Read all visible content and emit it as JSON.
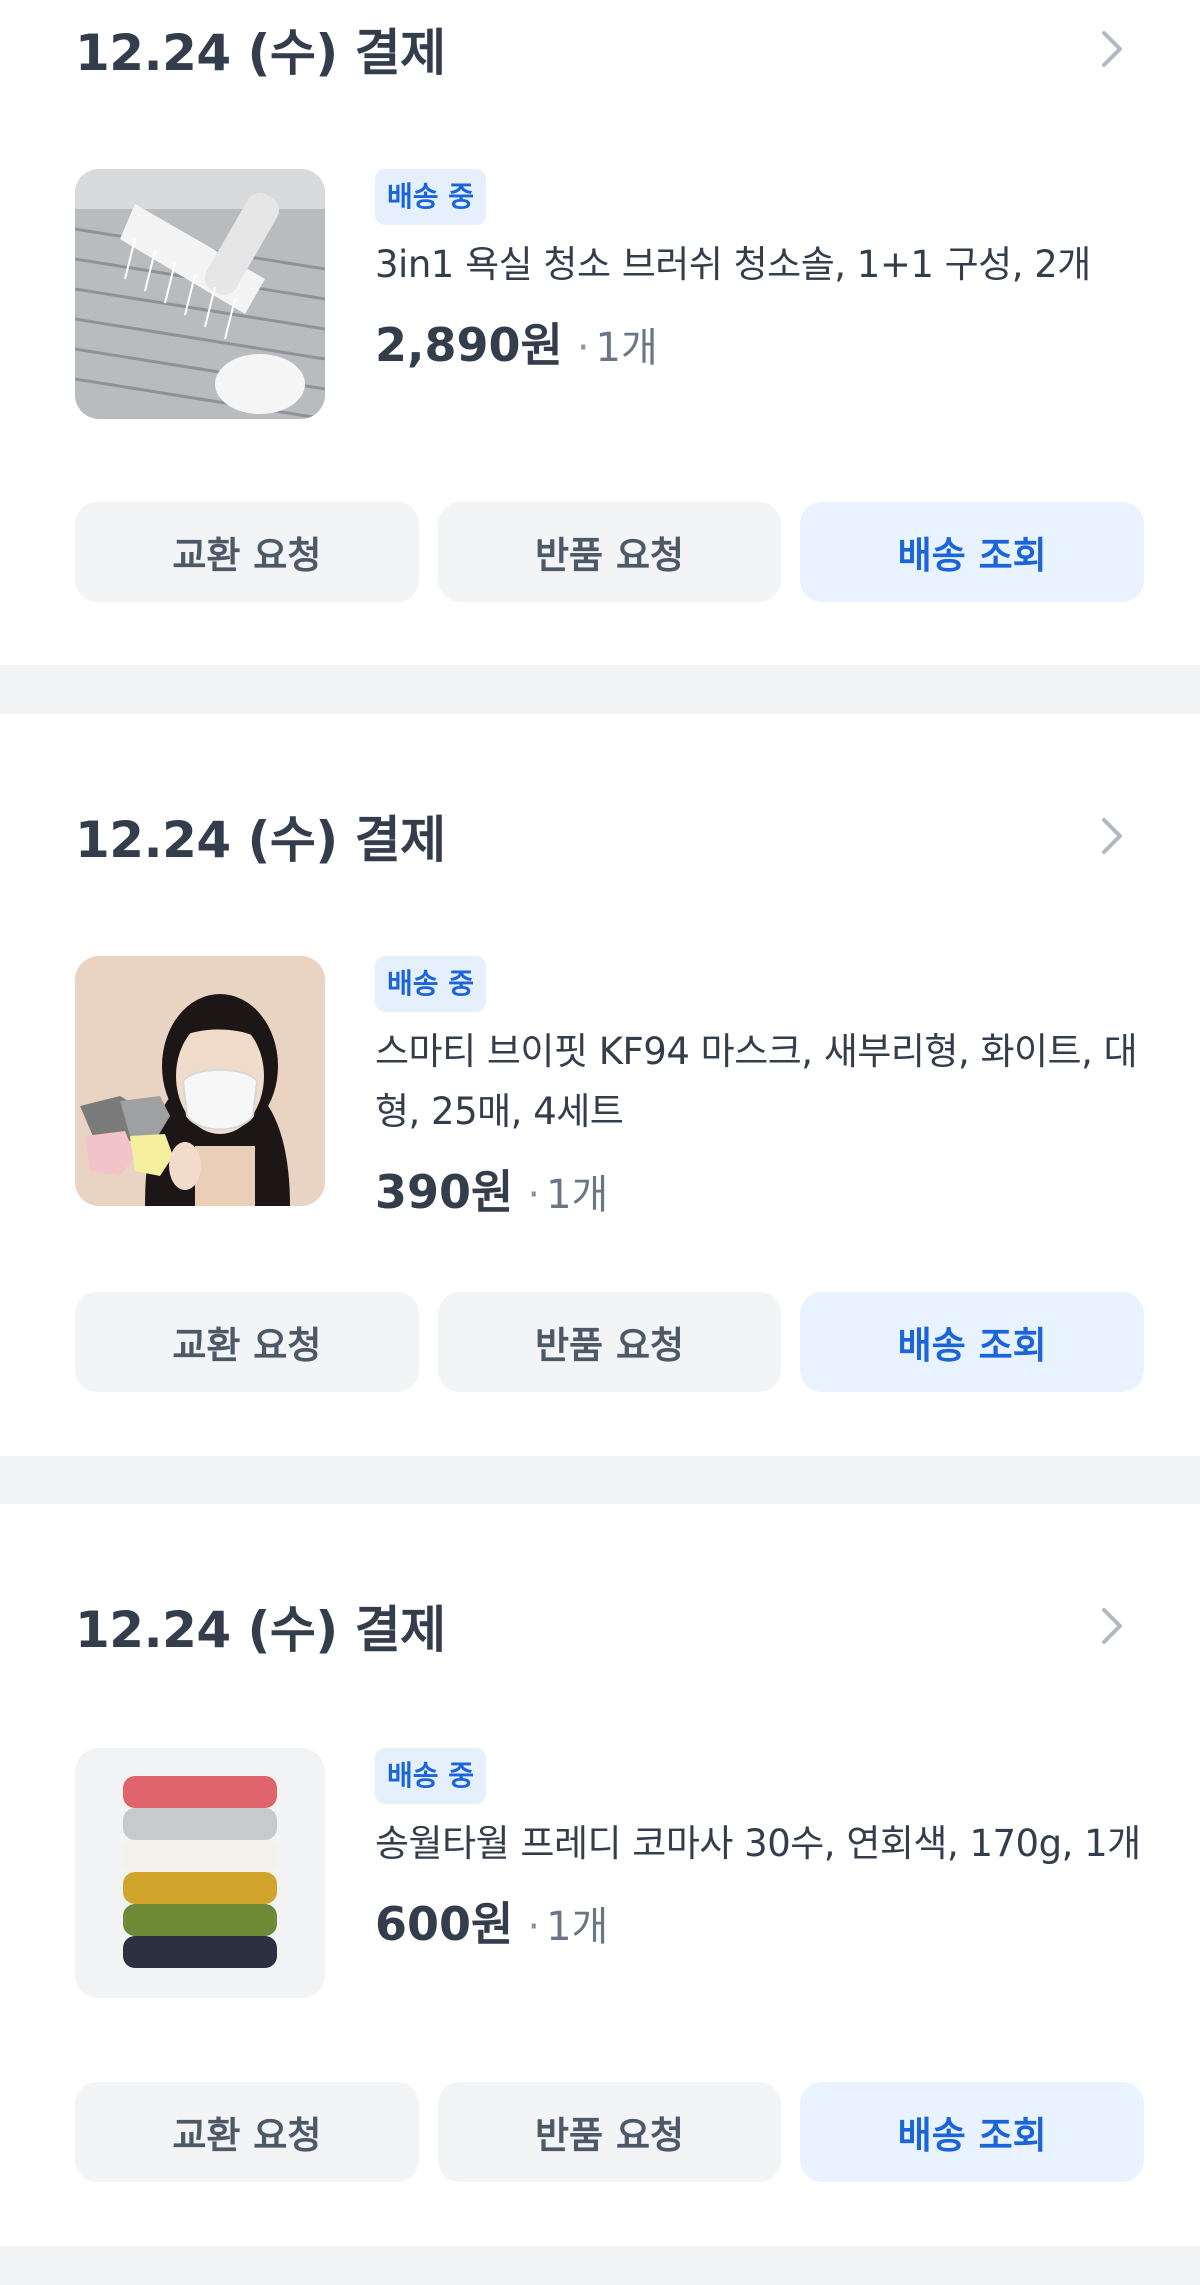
{
  "orders": [
    {
      "date": "12.24 (수) 결제",
      "status": "배송 중",
      "product_name": "3in1 욕실 청소 브러쉬 청소솔, 1+1 구성, 2개",
      "price": "2,890원",
      "quantity": "1개",
      "buttons": {
        "exchange": "교환 요청",
        "return": "반품 요청",
        "tracking": "배송 조회"
      }
    },
    {
      "date": "12.24 (수) 결제",
      "status": "배송 중",
      "product_name": "스마티 브이핏 KF94 마스크, 새부리형, 화이트, 대형, 25매, 4세트",
      "price": "390원",
      "quantity": "1개",
      "buttons": {
        "exchange": "교환 요청",
        "return": "반품 요청",
        "tracking": "배송 조회"
      }
    },
    {
      "date": "12.24 (수) 결제",
      "status": "배송 중",
      "product_name": "송월타월 프레디 코마사 30수, 연회색, 170g, 1개",
      "price": "600원",
      "quantity": "1개",
      "buttons": {
        "exchange": "교환 요청",
        "return": "반품 요청",
        "tracking": "배송 조회"
      }
    }
  ],
  "icons": {
    "chevron": "chevron-right-icon"
  },
  "colors": {
    "background": "#f2f3f5",
    "card": "#ffffff",
    "text_primary": "#333d4b",
    "text_secondary": "#6b7684",
    "accent": "#1b64da",
    "accent_bg": "#e8f3ff",
    "button_bg": "#f2f4f6"
  }
}
